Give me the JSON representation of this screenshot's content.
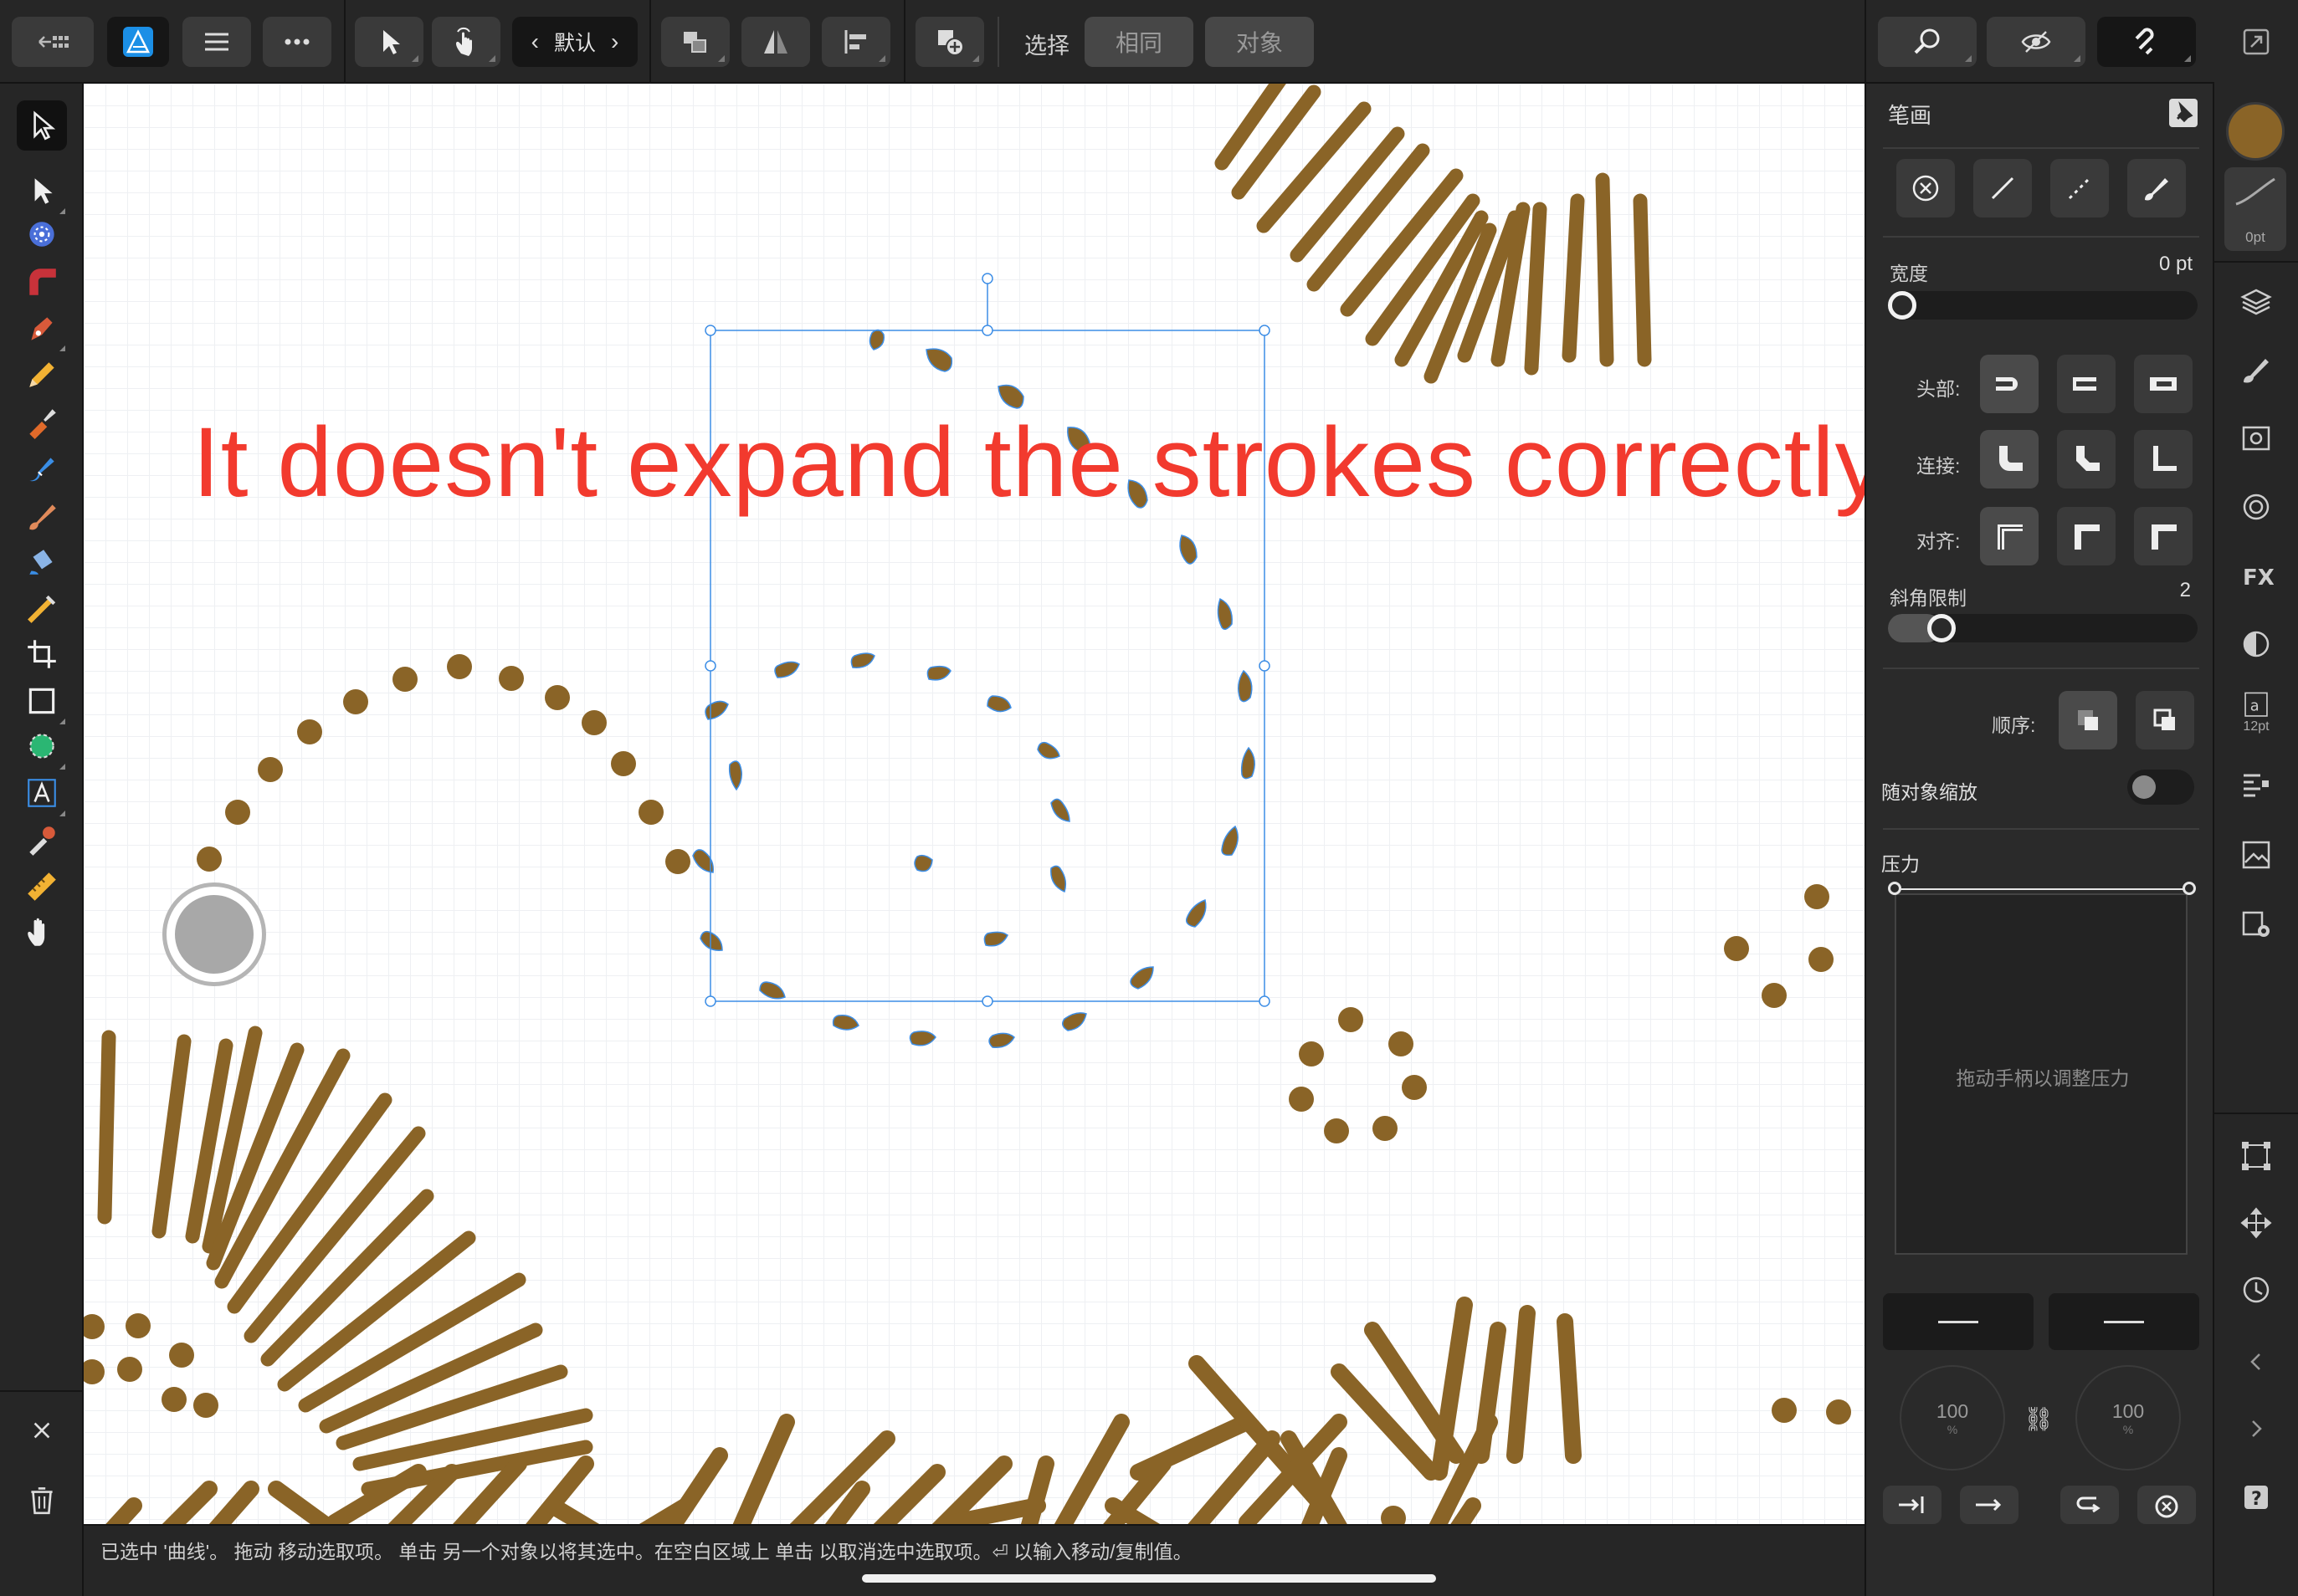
{
  "toolbar": {
    "preset_label": "默认",
    "select_label": "选择",
    "same_button": "相同",
    "object_button": "对象"
  },
  "annotation": {
    "text": "It doesn't expand the strokes correctly",
    "color": "#f23a2e"
  },
  "colors": {
    "stroke_brown": "#8a6427",
    "selection_blue": "#3d8ee6",
    "panel_bg": "#2a2a2a"
  },
  "stroke_panel": {
    "title": "笔画",
    "width_label": "宽度",
    "width_value": "0 pt",
    "width_fraction": 0.0,
    "head_label": "头部:",
    "join_label": "连接:",
    "align_label": "对齐:",
    "miter_label": "斜角限制",
    "miter_value": "2",
    "miter_fraction": 0.14,
    "order_label": "顺序:",
    "scale_with_object_label": "随对象缩放",
    "scale_with_object_on": false,
    "pressure_label": "压力",
    "pressure_hint": "拖动手柄以调整压力",
    "dial_left_value": "100",
    "dial_right_value": "100",
    "dial_unit": "%"
  },
  "right_strip": {
    "stroke_preview_label": "0pt",
    "text_style_label": "12pt"
  },
  "status_bar": {
    "text": "已选中 '曲线'。 拖动 移动选取项。 单击 另一个对象以将其选中。在空白区域上 单击 以取消选中选取项。⏎ 以输入移动/复制值。"
  },
  "icons": {
    "top": [
      "back-grid-icon",
      "affinity-designer-icon",
      "hamburger-menu-icon",
      "more-icon",
      "move-tool-icon",
      "touch-gesture-icon",
      "arrange-icon",
      "flip-icon",
      "align-icon",
      "add-shape-icon"
    ],
    "top_right": [
      "snapping-search-icon",
      "view-mode-icon",
      "magnet-icon",
      "window-icon"
    ],
    "left": [
      "move-tool-icon",
      "node-tool-icon",
      "corner-tool-icon",
      "point-transform-icon",
      "pen-tool-icon",
      "pencil-tool-icon",
      "vector-brush-icon",
      "fill-tool-icon",
      "paint-brush-icon",
      "vector-crop-icon",
      "crop-icon",
      "rectangle-tool-icon",
      "shape-tool-icon",
      "text-tool-icon",
      "eyedropper-icon",
      "ruler-icon",
      "hand-tool-icon",
      "close-icon",
      "trash-icon"
    ],
    "right": [
      "layers-icon",
      "brushes-icon",
      "appearance-icon",
      "transparency-icon",
      "fx-icon",
      "color-icon",
      "text-style-icon",
      "paragraph-icon",
      "stock-icon",
      "settings-icon",
      "transform-icon",
      "move-icon",
      "history-icon",
      "prev-icon",
      "next-icon",
      "help-icon"
    ]
  }
}
